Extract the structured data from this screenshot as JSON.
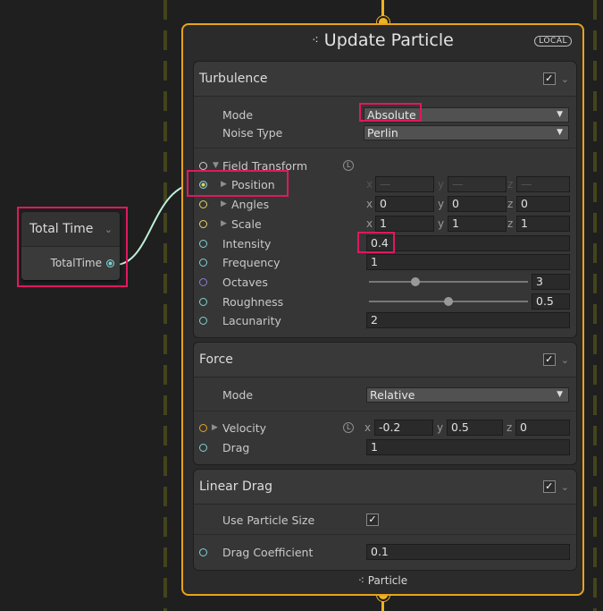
{
  "colors": {
    "accent": "#e8a31e",
    "highlight": "#e0185f",
    "slot_cyan": "#7fd3d3",
    "slot_yellow": "#e4d162",
    "slot_purple": "#8c7bd6"
  },
  "total_time_node": {
    "title": "Total Time",
    "output": "TotalTime"
  },
  "context": {
    "title": "Update Particle",
    "badge": "LOCAL",
    "footer": "Particle",
    "icon": "particle-icon"
  },
  "turbulence": {
    "title": "Turbulence",
    "enabled": "✓",
    "mode_label": "Mode",
    "mode_value": "Absolute",
    "noise_label": "Noise Type",
    "noise_value": "Perlin",
    "field_transform": "Field Transform",
    "L": "L",
    "position": "Position",
    "angles": "Angles",
    "scale": "Scale",
    "pos_x": "—",
    "pos_y": "—",
    "pos_z": "—",
    "ang_x": "0",
    "ang_y": "0",
    "ang_z": "0",
    "scl_x": "1",
    "scl_y": "1",
    "scl_z": "1",
    "intensity_label": "Intensity",
    "intensity": "0.4",
    "frequency_label": "Frequency",
    "frequency": "1",
    "octaves_label": "Octaves",
    "octaves": "3",
    "roughness_label": "Roughness",
    "roughness": "0.5",
    "lacunarity_label": "Lacunarity",
    "lacunarity": "2",
    "axis_x": "x",
    "axis_y": "y",
    "axis_z": "z"
  },
  "force": {
    "title": "Force",
    "enabled": "✓",
    "mode_label": "Mode",
    "mode_value": "Relative",
    "velocity_label": "Velocity",
    "vel_x": "-0.2",
    "vel_y": "0.5",
    "vel_z": "0",
    "drag_label": "Drag",
    "drag": "1"
  },
  "linear_drag": {
    "title": "Linear Drag",
    "enabled": "✓",
    "use_size_label": "Use Particle Size",
    "use_size": "✓",
    "coef_label": "Drag Coefficient",
    "coef": "0.1"
  }
}
